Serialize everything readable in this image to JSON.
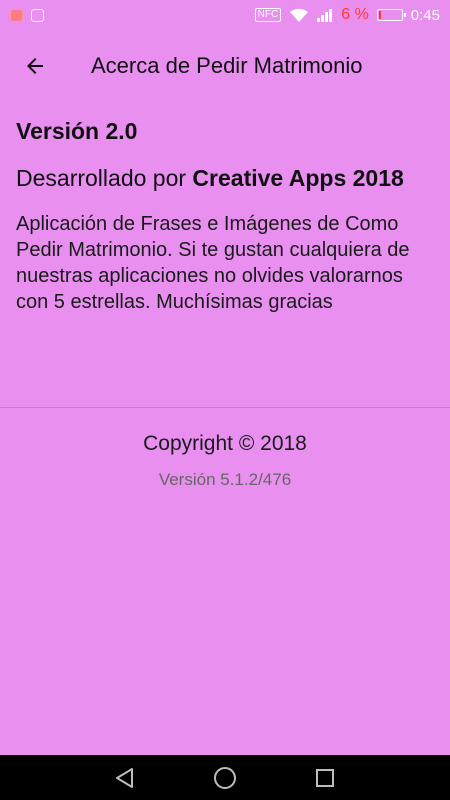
{
  "status_bar": {
    "nfc_label": "NFC",
    "battery_percent": "6 %",
    "battery_level": 0.06,
    "time": "0:45",
    "icons": [
      "notification-app-icon",
      "notification-image-icon",
      "nfc-icon",
      "wifi-icon",
      "signal-icon",
      "battery-icon"
    ]
  },
  "app_bar": {
    "title": "Acerca de Pedir Matrimonio",
    "back_icon": "arrow-left-icon"
  },
  "about": {
    "version_heading": "Versión 2.0",
    "developed_prefix": "Desarrollado por ",
    "developer_name": "Creative Apps 2018",
    "description": "Aplicación de Frases e Imágenes de Como Pedir Matrimonio. Si te gustan cualquiera de nuestras aplicaciones no olvides valorarnos con 5 estrellas. Muchísimas gracias",
    "copyright": "Copyright © 2018",
    "build_version": "Versión 5.1.2/476"
  },
  "nav_bar": {
    "icons": [
      "back-triangle-icon",
      "home-circle-icon",
      "recents-square-icon"
    ]
  },
  "colors": {
    "background": "#e88ff0",
    "status_text": "#ffffff",
    "battery_warning": "#ff3b30",
    "secondary_text": "#666666"
  }
}
